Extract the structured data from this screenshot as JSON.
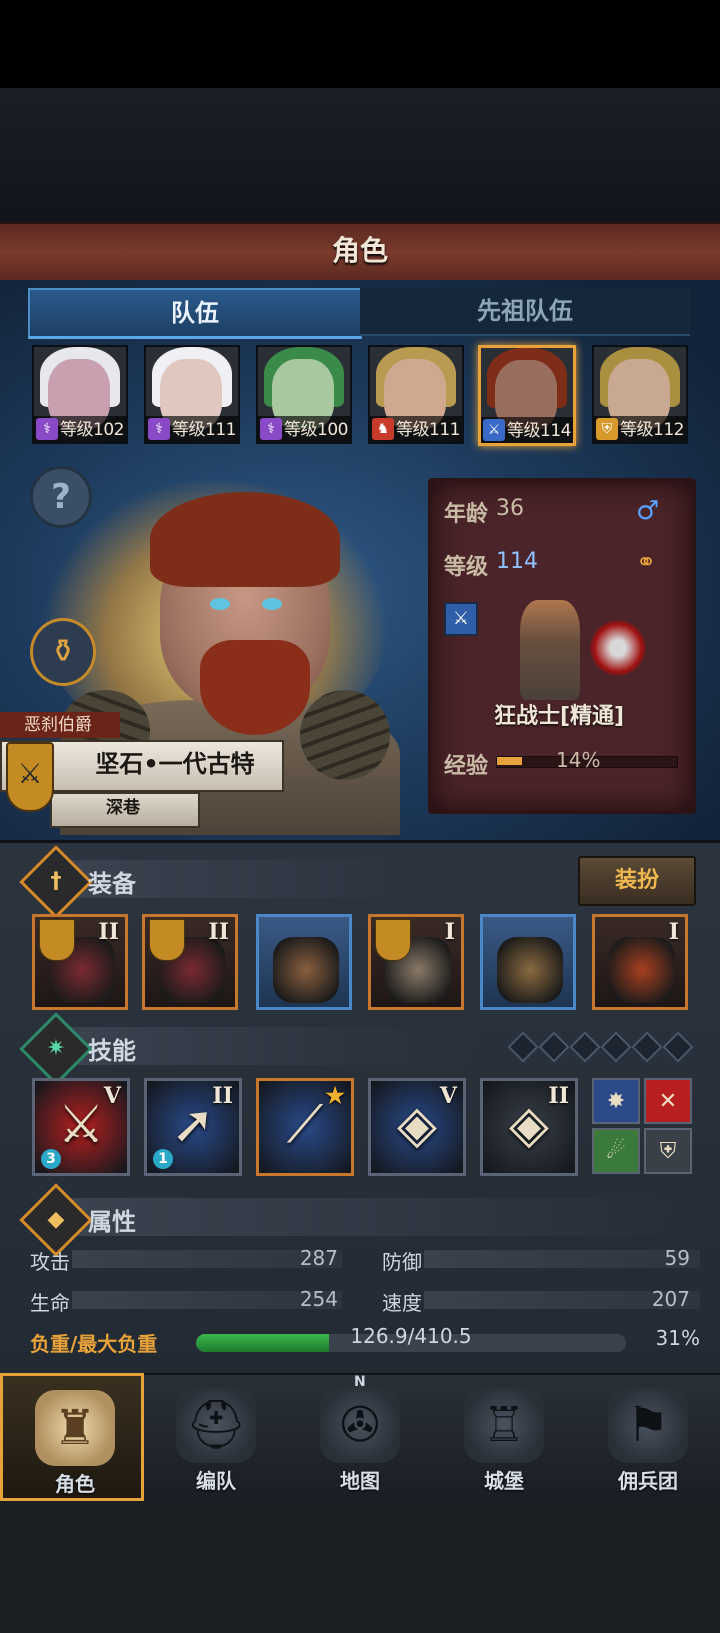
{
  "header": {
    "title": "角色"
  },
  "tabs": [
    {
      "label": "队伍",
      "active": true
    },
    {
      "label": "先祖队伍",
      "active": false
    }
  ],
  "roster": [
    {
      "level": "等级102",
      "class_icon": "staff-icon",
      "class_color": "#8a4ac8",
      "skin": "#c8a0b0",
      "hair": "#e8e8ec",
      "selected": false
    },
    {
      "level": "等级111",
      "class_icon": "staff-icon",
      "class_color": "#8a4ac8",
      "skin": "#e0c8c0",
      "hair": "#f0f0f4",
      "selected": false
    },
    {
      "level": "等级100",
      "class_icon": "staff-icon",
      "class_color": "#8a4ac8",
      "skin": "#a8c8a0",
      "hair": "#3a8a4a",
      "selected": false
    },
    {
      "level": "等级111",
      "class_icon": "beast-icon",
      "class_color": "#c83a2a",
      "skin": "#d0a890",
      "hair": "#b89a50",
      "selected": false
    },
    {
      "level": "等级114",
      "class_icon": "sword-icon",
      "class_color": "#3a6ac8",
      "skin": "#9a6e5e",
      "hair": "#7e2d18",
      "selected": true
    },
    {
      "level": "等级112",
      "class_icon": "shield-icon",
      "class_color": "#d89a2a",
      "skin": "#c8a890",
      "hair": "#a89040",
      "selected": false
    }
  ],
  "hero": {
    "title": "恶刹伯爵",
    "name": "坚石•一代古特",
    "origin": "深巷",
    "age_label": "年龄",
    "age": "36",
    "level_label": "等级",
    "level": "114",
    "gender_icon": "♂",
    "class_name": "狂战士[精通]",
    "exp_label": "经验",
    "exp_pct": "14%",
    "exp_fraction": 0.14
  },
  "equipment": {
    "title": "装备",
    "dress_button": "装扮",
    "items": [
      {
        "name": "axe-weapon",
        "rank": "II",
        "bannered": true,
        "rarity": "epic",
        "color": "#7a2a30"
      },
      {
        "name": "axe-weapon",
        "rank": "II",
        "bannered": true,
        "rarity": "epic",
        "color": "#7a2a30"
      },
      {
        "name": "helmet",
        "rank": "",
        "bannered": false,
        "rarity": "rare",
        "color": "#8a6040"
      },
      {
        "name": "fur-armor",
        "rank": "I",
        "bannered": true,
        "rarity": "epic",
        "color": "#8a7a68"
      },
      {
        "name": "leather-boots",
        "rank": "",
        "bannered": false,
        "rarity": "rare",
        "color": "#8a6a40"
      },
      {
        "name": "bat-amulet",
        "rank": "I",
        "bannered": false,
        "rarity": "epic",
        "color": "#a84020"
      }
    ]
  },
  "skills": {
    "title": "技能",
    "slots": [
      {
        "rank": "V",
        "bg": "#b82020",
        "glyph": "⚔",
        "count": "3",
        "hot": false
      },
      {
        "rank": "II",
        "bg": "#2a4a8a",
        "glyph": "➚",
        "count": "1",
        "hot": false
      },
      {
        "rank": "★",
        "bg": "#2a4a8a",
        "glyph": "⟋",
        "count": "",
        "hot": true
      },
      {
        "rank": "V",
        "bg": "#2a4a8a",
        "glyph": "◈",
        "count": "",
        "hot": false
      },
      {
        "rank": "II",
        "bg": "#3a4048",
        "glyph": "◈",
        "count": "",
        "hot": false
      }
    ],
    "mini": [
      {
        "glyph": "✸",
        "bg": "#2a4a8a"
      },
      {
        "glyph": "✕",
        "bg": "#b82020"
      },
      {
        "glyph": "☄",
        "bg": "#3a7a3a"
      },
      {
        "glyph": "⛨",
        "bg": "#3a4048"
      }
    ]
  },
  "attributes": {
    "title": "属性",
    "attack_label": "攻击",
    "attack": "287",
    "defense_label": "防御",
    "defense": "59",
    "hp_label": "生命",
    "hp": "254",
    "speed_label": "速度",
    "speed": "207",
    "load_label": "负重/最大负重",
    "load_value": "126.9/410.5",
    "load_pct": "31%",
    "load_fraction": 0.31
  },
  "nav": [
    {
      "label": "角色",
      "icon": "knight-icon",
      "active": true
    },
    {
      "label": "编队",
      "icon": "helmet-icon",
      "active": false
    },
    {
      "label": "地图",
      "icon": "compass-map-icon",
      "active": false
    },
    {
      "label": "城堡",
      "icon": "castle-icon",
      "active": false
    },
    {
      "label": "佣兵团",
      "icon": "banner-icon",
      "active": false
    }
  ],
  "compass_letter": "N"
}
